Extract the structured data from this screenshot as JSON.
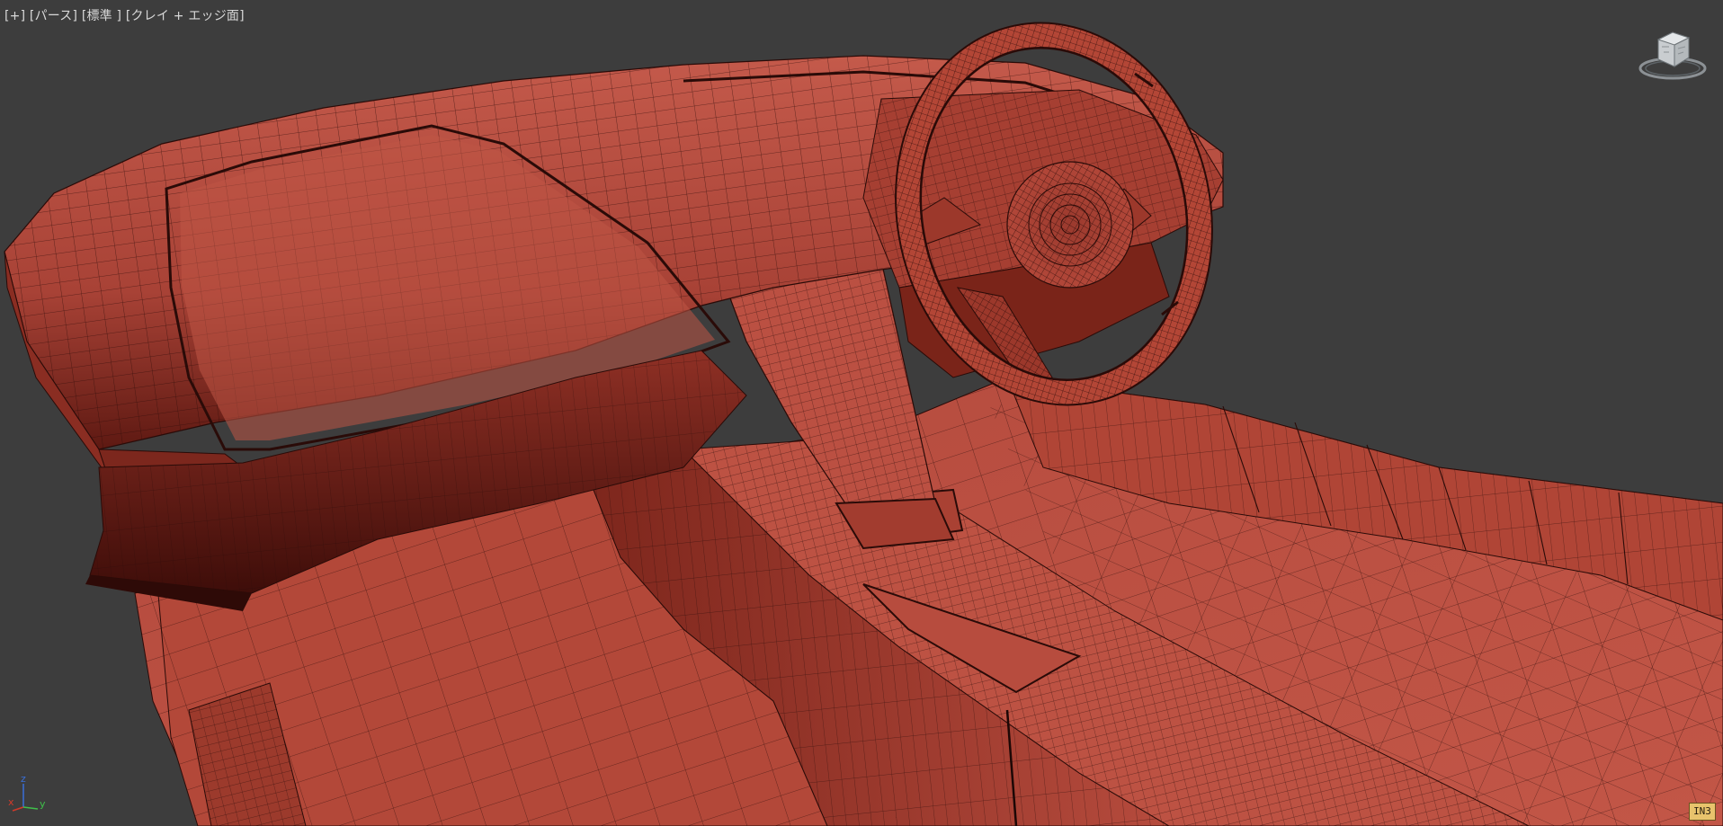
{
  "viewport": {
    "label_parts": [
      {
        "text": "[+]",
        "name": "viewport-menu-button"
      },
      {
        "text": "[パース]",
        "name": "viewport-view-button"
      },
      {
        "text": "[標準 ]",
        "name": "viewport-shading-quality-button"
      },
      {
        "text": "[クレイ + エッジ面]",
        "name": "viewport-shading-mode-button"
      }
    ],
    "axis": {
      "x": "x",
      "y": "y",
      "z": "z"
    },
    "corner_badge": "IN3"
  },
  "colors": {
    "background": "#3d3d3d",
    "mesh_base": "#b84a3c",
    "mesh_dark": "#6e1e18",
    "wire": "#2a0b08",
    "viewcube_face": "#cfd3d6",
    "axis_x": "#d03a2a",
    "axis_y": "#3fbf4a",
    "axis_z": "#3a6fd8"
  }
}
